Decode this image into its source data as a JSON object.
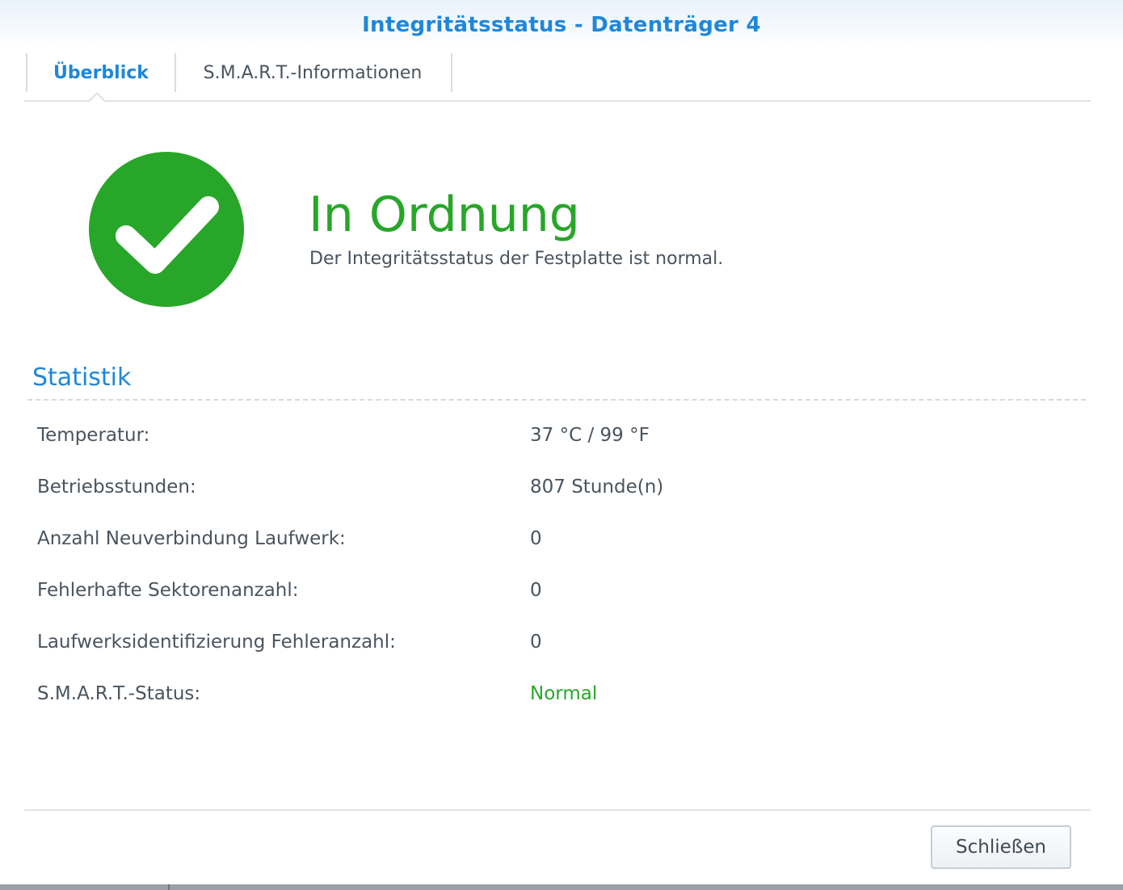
{
  "window": {
    "title": "Integritätsstatus - Datenträger 4"
  },
  "tabs": [
    {
      "label": "Überblick",
      "active": true
    },
    {
      "label": "S.M.A.R.T.-Informationen",
      "active": false
    }
  ],
  "status": {
    "icon": "check-circle-icon",
    "title": "In Ordnung",
    "description": "Der Integritätsstatus der Festplatte ist normal."
  },
  "statistics": {
    "section_title": "Statistik",
    "rows": [
      {
        "label": "Temperatur:",
        "value": "37 °C / 99 °F"
      },
      {
        "label": "Betriebsstunden:",
        "value": "807 Stunde(n)"
      },
      {
        "label": "Anzahl Neuverbindung Laufwerk:",
        "value": "0"
      },
      {
        "label": "Fehlerhafte Sektorenanzahl:",
        "value": "0"
      },
      {
        "label": "Laufwerksidentifizierung Fehleranzahl:",
        "value": "0"
      },
      {
        "label": "S.M.A.R.T.-Status:",
        "value": "Normal"
      }
    ]
  },
  "footer": {
    "close_label": "Schließen"
  },
  "colors": {
    "accent": "#1e87d9",
    "ok_green": "#28a629",
    "text": "#4a545e"
  }
}
